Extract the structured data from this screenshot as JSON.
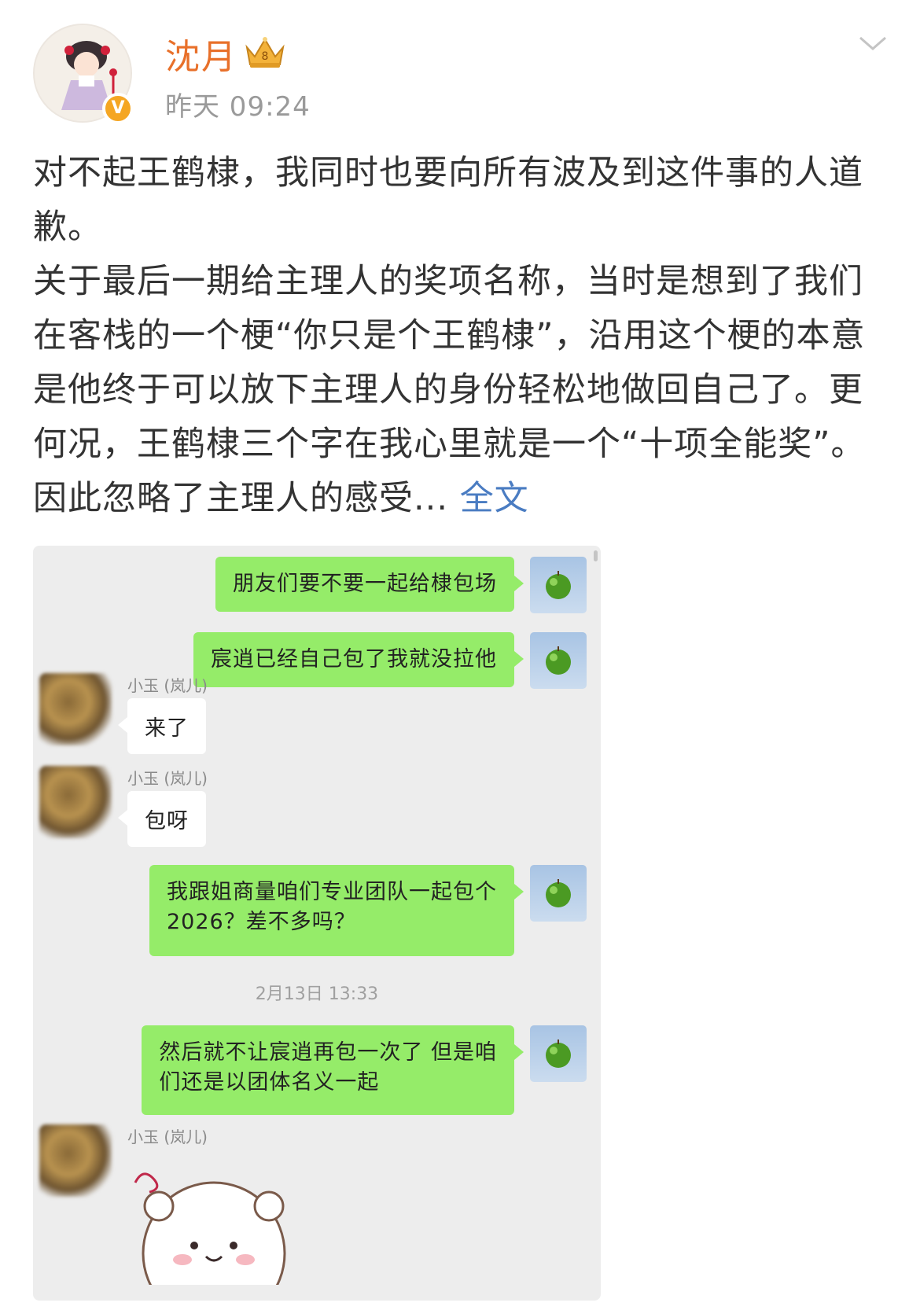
{
  "header": {
    "username": "沈月",
    "timestamp": "昨天 09:24",
    "verified_badge": "V",
    "icons": [
      "crown-icon",
      "chevron-down-icon",
      "verified-badge-icon"
    ],
    "accent_color": "#e8702a"
  },
  "post": {
    "paragraph1": "对不起王鹤棣，我同时也要向所有波及到这件事的人道歉。",
    "paragraph2": "关于最后一期给主理人的奖项名称，当时是想到了我们在客栈的一个梗“你只是个王鹤棣”，沿用这个梗的本意是他终于可以放下主理人的身份轻松地做回自己了。更何况，王鹤棣三个字在我心里就是一个“十项全能奖”。因此忽略了主理人的感受...",
    "more_link": "全文",
    "link_color": "#4a7cc2"
  },
  "chat": {
    "messages": [
      {
        "side": "right",
        "text": "朋友们要不要一起给棣包场"
      },
      {
        "side": "right",
        "text": "宸逍已经自己包了我就没拉他"
      },
      {
        "side": "left",
        "sender": "小玉 (岚儿)",
        "text": "来了"
      },
      {
        "side": "left",
        "sender": "小玉 (岚儿)",
        "text": "包呀"
      },
      {
        "side": "right",
        "line1": "我跟姐商量咱们专业团队一起包个",
        "line2": "2026？差不多吗？"
      },
      {
        "side": "right",
        "line1": "然后就不让宸逍再包一次了 但是咱",
        "line2": "们还是以团体名义一起"
      },
      {
        "side": "left",
        "sender": "小玉 (岚儿)",
        "sticker": "sticker-icon"
      }
    ],
    "time_divider": "2月13日 13:33",
    "bubble_color": "#95ec69"
  }
}
